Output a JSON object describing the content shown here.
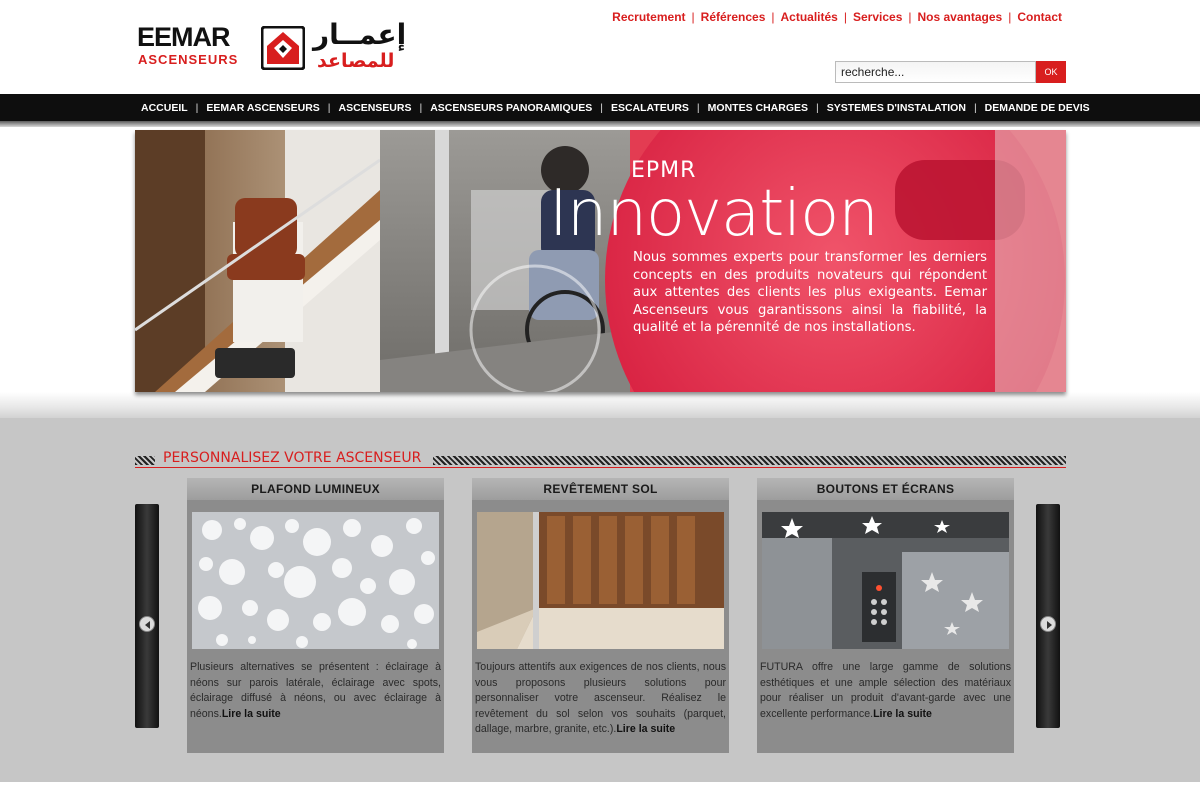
{
  "brand": {
    "latin_name": "EEMAR",
    "latin_sub": "ASCENSEURS",
    "arabic_name": "إعمــار",
    "arabic_sub": "للمصاعد"
  },
  "top_links": [
    "Recrutement",
    "Références",
    "Actualités",
    "Services",
    "Nos avantages",
    "Contact"
  ],
  "search": {
    "value": "recherche...",
    "button": "OK"
  },
  "nav": [
    "ACCUEIL",
    "EEMAR ASCENSEURS",
    "ASCENSEURS",
    "ASCENSEURS PANORAMIQUES",
    "ESCALATEURS",
    "MONTES CHARGES",
    "SYSTEMES D'INSTALATION",
    "DEMANDE DE DEVIS"
  ],
  "banner": {
    "kicker": "EPMR",
    "title": "Innovation",
    "text": "Nous sommes experts pour transformer les derniers concepts en des produits novateurs qui répondent aux attentes des clients les plus exigeants. Eemar Ascenseurs vous garantissons ainsi la fiabilité, la qualité et la pérennité de nos installations."
  },
  "section": {
    "title": "PERSONNALISEZ VOTRE ASCENSEUR"
  },
  "cards": [
    {
      "title": "PLAFOND LUMINEUX",
      "text": "Plusieurs alternatives se présentent : éclairage à néons sur parois latérale, éclairage avec spots, éclairage diffusé à néons, ou avec éclairage à néons.",
      "more": "Lire la suite"
    },
    {
      "title": "REVÊTEMENT SOL",
      "text": "Toujours attentifs aux exigences de nos clients, nous vous proposons plusieurs solutions pour personnaliser votre ascenseur. Réalisez le revêtement du sol selon vos souhaits (parquet, dallage, marbre, granite, etc.).",
      "more": "Lire la suite"
    },
    {
      "title": "BOUTONS ET ÉCRANS",
      "text": "FUTURA offre une large gamme de solutions esthétiques et une ample sélection des matériaux pour réaliser un produit d'avant-garde avec une excellente performance.",
      "more": "Lire la suite"
    }
  ],
  "colors": {
    "accent": "#d81e1e",
    "nav_bg": "#0e0e0e",
    "section_bg": "#c6c6c6",
    "card_bg": "#8c8c8c"
  },
  "icons": {
    "prev": "arrow-left-icon",
    "next": "arrow-right-icon"
  }
}
